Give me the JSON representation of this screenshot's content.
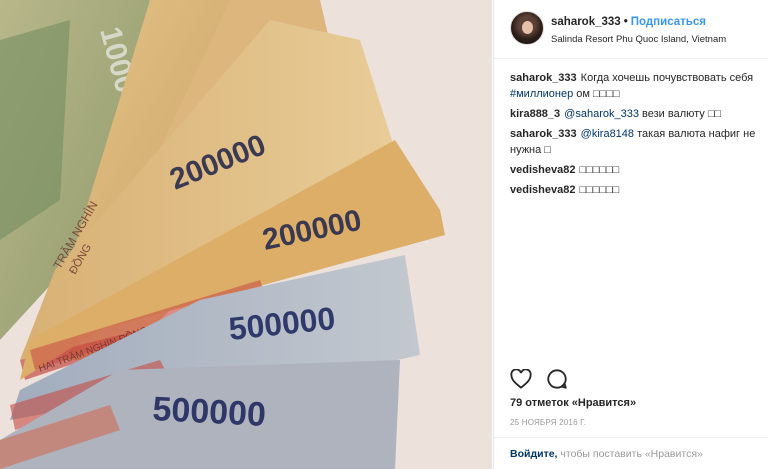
{
  "post": {
    "username": "saharok_333",
    "follow_label": "Подписаться",
    "location": "Salinda Resort Phu Quoc Island, Vietnam",
    "likes_text": "79 отметок «Нравится»",
    "date_text": "25 НОЯБРЯ 2016 Г.",
    "login_link": "Войдите,",
    "login_rest": " чтобы поставить «Нравится»"
  },
  "comments": [
    {
      "user": "saharok_333",
      "text": "Когда хочешь почувствовать себя ",
      "tag": "#миллионер",
      "tail": " ом □□□□"
    },
    {
      "user": "kira888_3",
      "mention": "@saharok_333",
      "text": " вези валюту □□"
    },
    {
      "user": "saharok_333",
      "mention": "@kira8148",
      "text": " такая валюта нафиг не нужна □"
    },
    {
      "user": "vedisheva82",
      "text": "□□□□□□"
    },
    {
      "user": "vedisheva82",
      "text": "□□□□□□"
    }
  ],
  "banknotes": {
    "d1": "1000",
    "d2": "200000",
    "d3": "200000",
    "d4": "500000",
    "d5": "500000",
    "words1": "TRĂM NGHÌN",
    "words2": "ĐỒNG",
    "words3": "HAI TRĂM NGHÌN ĐỒNG"
  },
  "icons": {
    "like": "heart-icon",
    "comment": "comment-bubble-icon",
    "avatar": "profile-avatar"
  },
  "colors": {
    "accent": "#3897f0",
    "link": "#003569",
    "note_tan": "#d9b06b",
    "note_blue": "#9aa6b8",
    "note_red": "#c23a3a"
  }
}
